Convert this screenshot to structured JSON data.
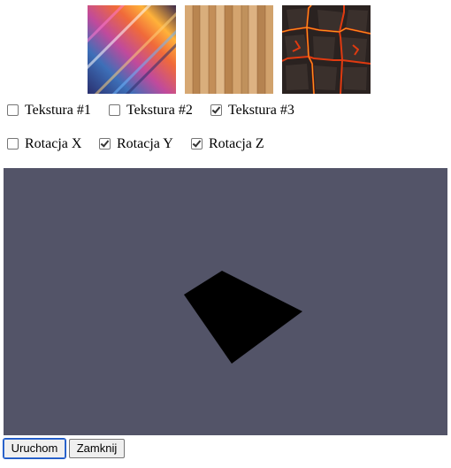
{
  "textures": [
    {
      "name": "Tekstura #1",
      "checked": false,
      "image": "colorful-streaks-texture"
    },
    {
      "name": "Tekstura #2",
      "checked": false,
      "image": "wood-planks-texture"
    },
    {
      "name": "Tekstura #3",
      "checked": true,
      "image": "lava-cracks-texture"
    }
  ],
  "rotations": [
    {
      "label": "Rotacja X",
      "checked": false
    },
    {
      "label": "Rotacja Y",
      "checked": true
    },
    {
      "label": "Rotacja Z",
      "checked": true
    }
  ],
  "scene": {
    "background_color": "#535468",
    "shape_color": "#000000"
  },
  "buttons": {
    "run": "Uruchom",
    "close": "Zamknij"
  }
}
